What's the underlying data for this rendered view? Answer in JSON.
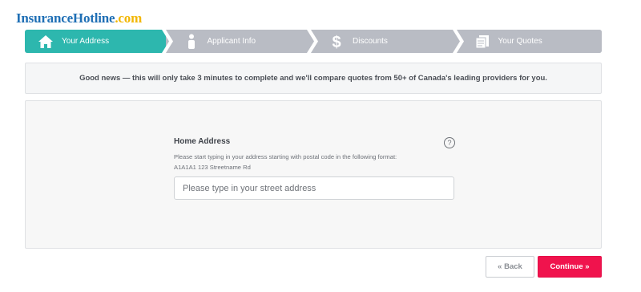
{
  "logo": {
    "brand": "InsuranceHotline",
    "tld": ".com"
  },
  "steps": [
    {
      "label": "Your Address",
      "icon": "home-icon",
      "active": true
    },
    {
      "label": "Applicant Info",
      "icon": "person-icon",
      "active": false
    },
    {
      "label": "Discounts",
      "icon": "dollar-icon",
      "active": false
    },
    {
      "label": "Your Quotes",
      "icon": "documents-icon",
      "active": false
    }
  ],
  "notice": "Good news — this will only take 3 minutes to complete and we'll compare quotes from 50+ of Canada's leading providers for you.",
  "address_field": {
    "label": "Home Address",
    "help": "?",
    "hint": "Please start typing in your address starting with postal code in the following format: A1A1A1 123 Streetname Rd",
    "value": "",
    "placeholder": "Please type in your street address"
  },
  "buttons": {
    "back": "« Back",
    "continue": "Continue »"
  },
  "colors": {
    "active_step": "#2db7ae",
    "inactive_step": "#b9bcc4",
    "continue": "#f0134d",
    "logo_brand": "#1f6fb5",
    "logo_tld": "#f2b705"
  }
}
